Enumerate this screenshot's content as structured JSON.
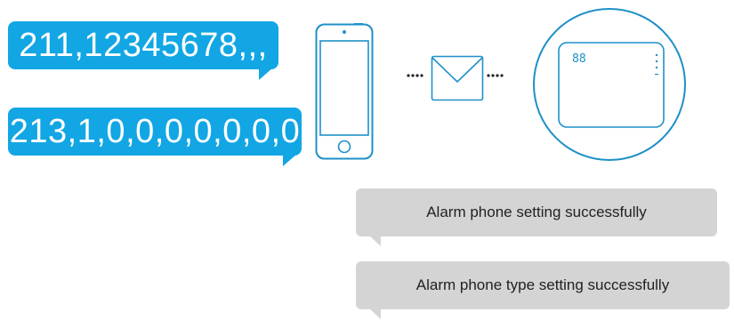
{
  "messages": {
    "command_1": "211,12345678,,,",
    "command_2": "213,1,0,0,0,0,0,0,0"
  },
  "replies": {
    "reply_1": "Alarm phone setting successfully",
    "reply_2": "Alarm phone type setting successfully"
  },
  "device": {
    "display": "88"
  },
  "colors": {
    "command_bubble": "#12a6e4",
    "reply_bubble": "#d4d4d4",
    "device_outline": "#1e90c8"
  },
  "icons": {
    "phone": "smartphone-icon",
    "sms": "envelope-icon",
    "panel": "alarm-panel-icon"
  }
}
